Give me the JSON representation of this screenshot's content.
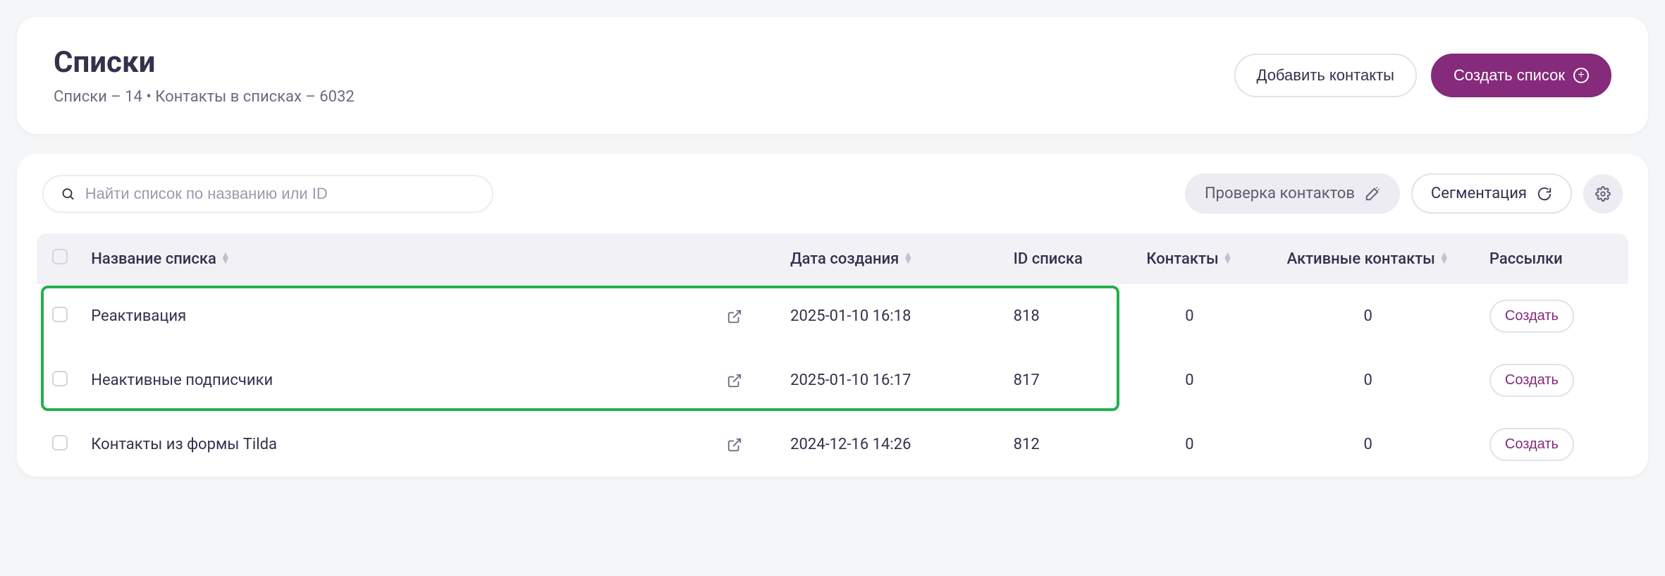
{
  "header": {
    "title": "Списки",
    "subtitle": "Списки – 14 • Контакты в списках – 6032",
    "add_contacts": "Добавить контакты",
    "create_list": "Создать список"
  },
  "toolbar": {
    "search_placeholder": "Найти список по названию или ID",
    "check_contacts": "Проверка контактов",
    "segmentation": "Сегментация"
  },
  "columns": {
    "name": "Название списка",
    "date": "Дата создания",
    "id": "ID списка",
    "contacts": "Контакты",
    "active": "Активные контакты",
    "mailings": "Рассылки"
  },
  "rows": [
    {
      "name": "Реактивация",
      "date": "2025-01-10 16:18",
      "id": "818",
      "contacts": "0",
      "active": "0",
      "btn": "Создать"
    },
    {
      "name": "Неактивные подписчики",
      "date": "2025-01-10 16:17",
      "id": "817",
      "contacts": "0",
      "active": "0",
      "btn": "Создать"
    },
    {
      "name": "Контакты из формы Tilda",
      "date": "2024-12-16 14:26",
      "id": "812",
      "contacts": "0",
      "active": "0",
      "btn": "Создать"
    }
  ]
}
